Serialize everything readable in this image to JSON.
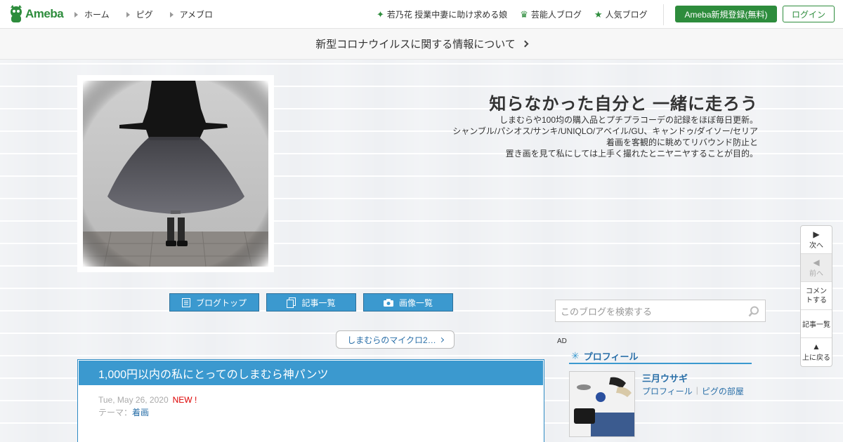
{
  "topbar": {
    "logo_text": "Ameba",
    "nav": [
      "ホーム",
      "ピグ",
      "アメブロ"
    ],
    "links": [
      {
        "icon": "sparkle-icon",
        "label": "若乃花 授業中妻に助け求める娘"
      },
      {
        "icon": "crown-icon",
        "label": "芸能人ブログ"
      },
      {
        "icon": "star-icon",
        "label": "人気ブログ"
      }
    ],
    "register_label": "Ameba新規登録(無料)",
    "login_label": "ログイン"
  },
  "notice": {
    "text": "新型コロナウイルスに関する情報について"
  },
  "header": {
    "title": "知らなかった自分と 一緒に走ろう",
    "description": [
      "しまむらや100均の購入品とプチプラコーデの記録をほぼ毎日更新。",
      "シャンブル/パシオス/サンキ/UNIQLO/アベイル/GU、キャンドゥ/ダイソー/セリア",
      "着画を客観的に眺めてリバウンド防止と",
      "置き画を見て私にしては上手く撮れたとニヤニヤすることが目的。"
    ]
  },
  "blognav": {
    "top": "ブログトップ",
    "entries": "記事一覧",
    "images": "画像一覧"
  },
  "search": {
    "placeholder": "このブログを検索する"
  },
  "sidenav": {
    "next": "次へ",
    "prev": "前へ",
    "comment": "コメントする",
    "list": "記事一覧",
    "top": "上に戻る"
  },
  "theme_pill": {
    "label": "しまむらのマイクロ2…"
  },
  "article": {
    "title": "1,000円以内の私にとってのしまむら神パンツ",
    "date": "Tue, May 26, 2020",
    "new_badge": "NEW !",
    "theme_label": "テーマ：",
    "theme": "着画"
  },
  "sidebar": {
    "ad_label": "AD",
    "profile_heading": "プロフィール",
    "profile_name": "三月ウサギ",
    "profile_link": "プロフィール",
    "pig_link": "ピグの部屋"
  },
  "colors": {
    "brand_green": "#2d8c3c",
    "accent_blue": "#3b99cf",
    "link_blue": "#2a6fa8",
    "new_red": "#dd0000"
  }
}
